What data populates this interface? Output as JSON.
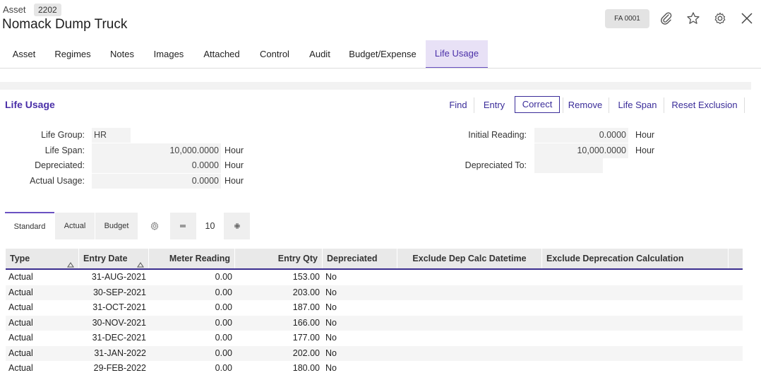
{
  "header": {
    "module_label": "Asset",
    "asset_number": "2202",
    "title": "Nomack  Dump Truck",
    "record_chip": "FA 0001"
  },
  "tabs": [
    "Asset",
    "Regimes",
    "Notes",
    "Images",
    "Attached",
    "Control",
    "Audit",
    "Budget/Expense",
    "Life Usage"
  ],
  "active_tab": "Life Usage",
  "section": {
    "title": "Life Usage",
    "actions": [
      "Find",
      "Entry",
      "Correct",
      "Remove",
      "Life Span",
      "Reset Exclusion"
    ],
    "active_action": "Correct"
  },
  "form": {
    "life_group_label": "Life Group:",
    "life_group": "HR",
    "life_span_label": "Life Span:",
    "life_span": "10,000.0000",
    "depreciated_label": "Depreciated:",
    "depreciated": "0.0000",
    "actual_usage_label": "Actual Usage:",
    "actual_usage": "0.0000",
    "initial_reading_label": "Initial Reading:",
    "initial_reading": "0.0000",
    "second_reading": "10,000.0000",
    "depreciated_to_label": "Depreciated To:",
    "depreciated_to": "",
    "unit": "Hour"
  },
  "toolbar": {
    "views": [
      "Standard",
      "Actual",
      "Budget"
    ],
    "active_view": "Standard",
    "page_size": "10"
  },
  "grid": {
    "columns": [
      "Type",
      "Entry Date",
      "Meter Reading",
      "Entry Qty",
      "Depreciated",
      "Exclude Dep Calc Datetime",
      "Exclude Deprecation Calculation"
    ],
    "rows": [
      {
        "type": "Actual",
        "date": "31-AUG-2021",
        "meter": "0.00",
        "qty": "153.00",
        "dep": "No"
      },
      {
        "type": "Actual",
        "date": "30-SEP-2021",
        "meter": "0.00",
        "qty": "203.00",
        "dep": "No"
      },
      {
        "type": "Actual",
        "date": "31-OCT-2021",
        "meter": "0.00",
        "qty": "187.00",
        "dep": "No"
      },
      {
        "type": "Actual",
        "date": "30-NOV-2021",
        "meter": "0.00",
        "qty": "166.00",
        "dep": "No"
      },
      {
        "type": "Actual",
        "date": "31-DEC-2021",
        "meter": "0.00",
        "qty": "177.00",
        "dep": "No"
      },
      {
        "type": "Actual",
        "date": "31-JAN-2022",
        "meter": "0.00",
        "qty": "202.00",
        "dep": "No"
      },
      {
        "type": "Actual",
        "date": "29-FEB-2022",
        "meter": "0.00",
        "qty": "180.00",
        "dep": "No"
      }
    ]
  },
  "colors": {
    "accent": "#4a2fa8",
    "active_tab_bg": "#e8e1f6",
    "grid_header": "#e9e9e9"
  },
  "icons": [
    "paperclip-icon",
    "star-icon",
    "gear-icon",
    "close-icon",
    "settings-gear-icon",
    "minus-icon",
    "plus-icon",
    "sort-asc-icon"
  ]
}
